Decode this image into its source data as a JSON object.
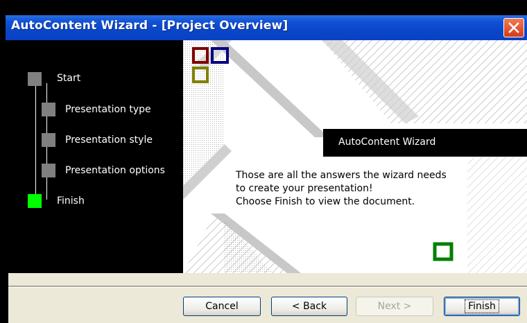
{
  "window": {
    "title": "AutoContent Wizard - [Project Overview]",
    "close_symbol": "✕"
  },
  "steps": [
    {
      "label": "Start",
      "state": "done"
    },
    {
      "label": "Presentation type",
      "state": "done"
    },
    {
      "label": "Presentation style",
      "state": "done"
    },
    {
      "label": "Presentation options",
      "state": "done"
    },
    {
      "label": "Finish",
      "state": "current"
    }
  ],
  "panel": {
    "banner": "AutoContent Wizard",
    "message_lines": [
      "Those are all the answers the wizard needs",
      "to create your presentation!",
      "Choose Finish to view the document."
    ]
  },
  "buttons": {
    "cancel": "Cancel",
    "back": "< Back",
    "next": "Next >",
    "finish": "Finish"
  },
  "colors": {
    "titlebar": "#0a46c8",
    "step_done": "#808080",
    "step_current": "#00ff00",
    "square_red": "#800000",
    "square_blue": "#000080",
    "square_olive": "#808000",
    "square_green": "#008000"
  }
}
